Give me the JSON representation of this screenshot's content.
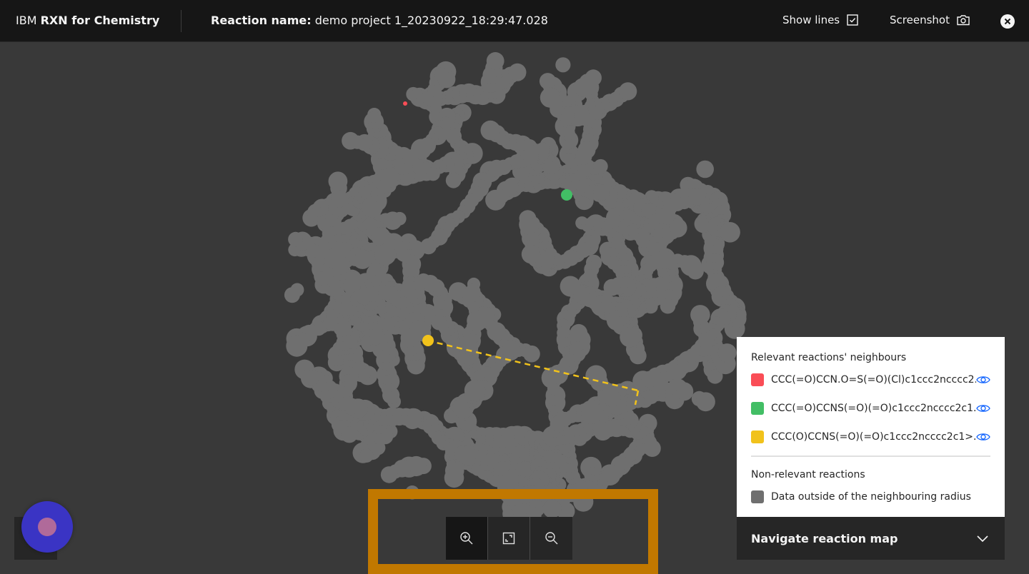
{
  "header": {
    "brand_prefix": "IBM",
    "brand_name": "RXN for Chemistry",
    "reaction_label": "Reaction name:",
    "reaction_value": "demo project 1_20230922_18:29:47.028",
    "show_lines_label": "Show lines",
    "show_lines_checked": true,
    "screenshot_label": "Screenshot"
  },
  "map": {
    "background_color": "#393939",
    "cloud_color": "#6f6f6f",
    "highlights": [
      {
        "name": "red",
        "color": "#fa4d56"
      },
      {
        "name": "green",
        "color": "#42be65"
      },
      {
        "name": "yellow",
        "color": "#f1c21b"
      }
    ]
  },
  "zoom_controls": {
    "zoom_in": "zoom-in",
    "fit": "fit-to-screen",
    "zoom_out": "zoom-out",
    "highlight_color": "#c17800"
  },
  "legend": {
    "relevant_heading": "Relevant reactions' neighbours",
    "relevant_items": [
      {
        "color": "#fa4d56",
        "label": "CCC(=O)CCN.O=S(=O)(Cl)c1ccc2ncccc2..."
      },
      {
        "color": "#42be65",
        "label": "CCC(=O)CCNS(=O)(=O)c1ccc2ncccc2c1..."
      },
      {
        "color": "#f1c21b",
        "label": "CCC(O)CCNS(=O)(=O)c1ccc2ncccc2c1>..."
      }
    ],
    "nonrelevant_heading": "Non-relevant reactions",
    "nonrelevant_items": [
      {
        "color": "#6f6f6f",
        "label": "Data outside of the neighbouring radius"
      }
    ]
  },
  "navigate": {
    "label": "Navigate reaction map"
  }
}
